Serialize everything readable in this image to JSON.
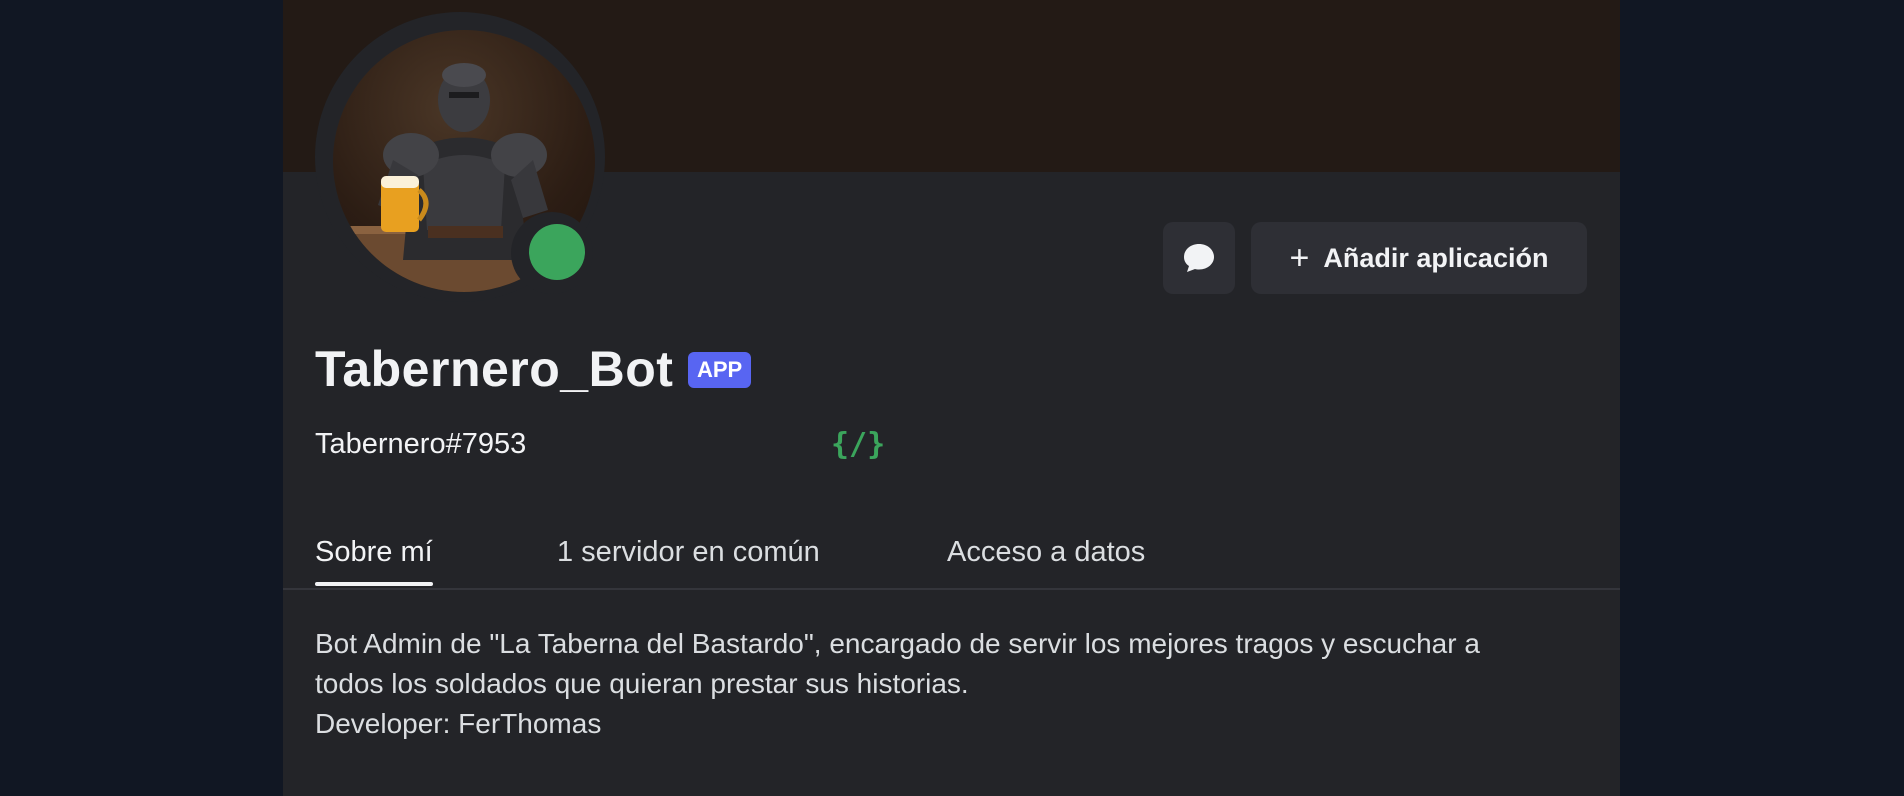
{
  "profile": {
    "display_name": "Tabernero_Bot",
    "app_badge": "APP",
    "username": "Tabernero#7953",
    "slash_commands_icon": "{/}",
    "status": "online",
    "status_color": "#3ba55c",
    "banner_color": "#231a15",
    "avatar_icon": "armored-knight-holding-beer-avatar"
  },
  "actions": {
    "message_icon": "speech-bubble-icon",
    "add_app_label": "Añadir aplicación",
    "add_icon": "+"
  },
  "tabs": [
    {
      "label": "Sobre mí",
      "active": true
    },
    {
      "label": "1 servidor en común",
      "active": false
    },
    {
      "label": "Acceso a datos",
      "active": false
    }
  ],
  "bio": {
    "line1": "Bot Admin de \"La Taberna del Bastardo\", encargado de servir los mejores tragos y escuchar a",
    "line2": "todos los soldados que quieran prestar sus historias.",
    "line3": "Developer: FerThomas"
  },
  "colors": {
    "background": "#111723",
    "card": "#232428",
    "accent": "#5865f2"
  }
}
